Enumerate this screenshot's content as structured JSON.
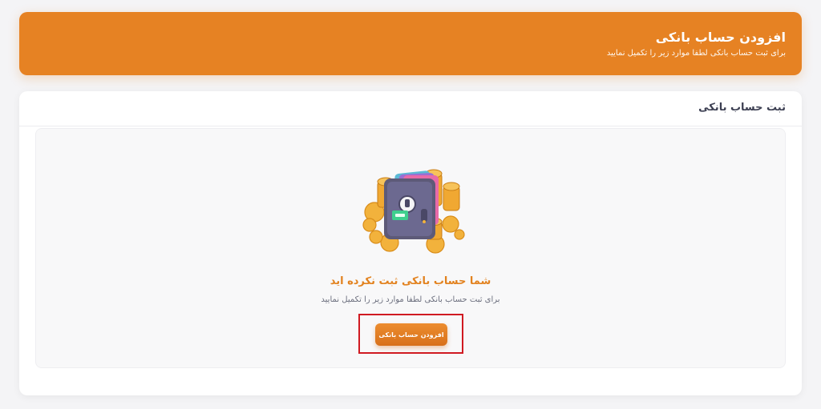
{
  "header": {
    "title": "افزودن حساب بانکی",
    "subtitle": "برای ثبت حساب بانکی لطفا موارد زیر را تکمیل نمایید"
  },
  "card": {
    "title": "ثبت حساب بانکی"
  },
  "empty_state": {
    "illustration": "wallet-with-coins-icon",
    "title": "شما حساب بانکی ثبت نکرده اید",
    "subtitle": "برای ثبت حساب بانکی لطفا موارد زیر را تکمیل نمایید",
    "button_label": "افزودن حساب بانکی"
  },
  "colors": {
    "accent": "#e68223",
    "highlight_frame": "#d01a22"
  }
}
